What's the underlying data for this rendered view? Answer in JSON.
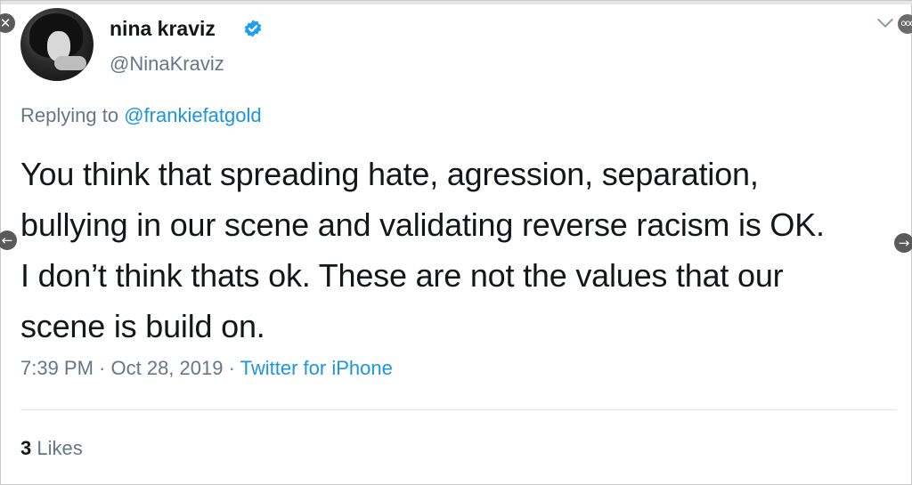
{
  "author": {
    "name": "nina kraviz",
    "handle": "@NinaKraviz",
    "verified": true
  },
  "reply": {
    "prefix": "Replying to",
    "mention": "@frankiefatgold"
  },
  "tweet": {
    "lines": [
      "You think that spreading hate, agression, separation,",
      "bullying in our scene and validating reverse racism is OK.",
      "I don’t think thats ok. These are not the values that our",
      "scene is build on."
    ]
  },
  "meta": {
    "time": "7:39 PM",
    "separator1": " · ",
    "date": "Oct 28, 2019",
    "separator2": " · ",
    "source": "Twitter for iPhone"
  },
  "stats": {
    "likes_count": "3",
    "likes_label": "Likes"
  },
  "overlay": {
    "close_glyph": "✕",
    "prev_glyph": "←",
    "next_glyph": "→",
    "more_glyph": "ooo"
  },
  "colors": {
    "text": "#14171a",
    "secondary": "#657786",
    "link": "#1b95e0",
    "verified": "#1da1f2"
  },
  "icons": {
    "verified": "verified-badge-icon",
    "caret": "chevron-down-icon",
    "close": "close-icon",
    "prev": "arrow-left-icon",
    "next": "arrow-right-icon",
    "more": "more-options-icon"
  }
}
